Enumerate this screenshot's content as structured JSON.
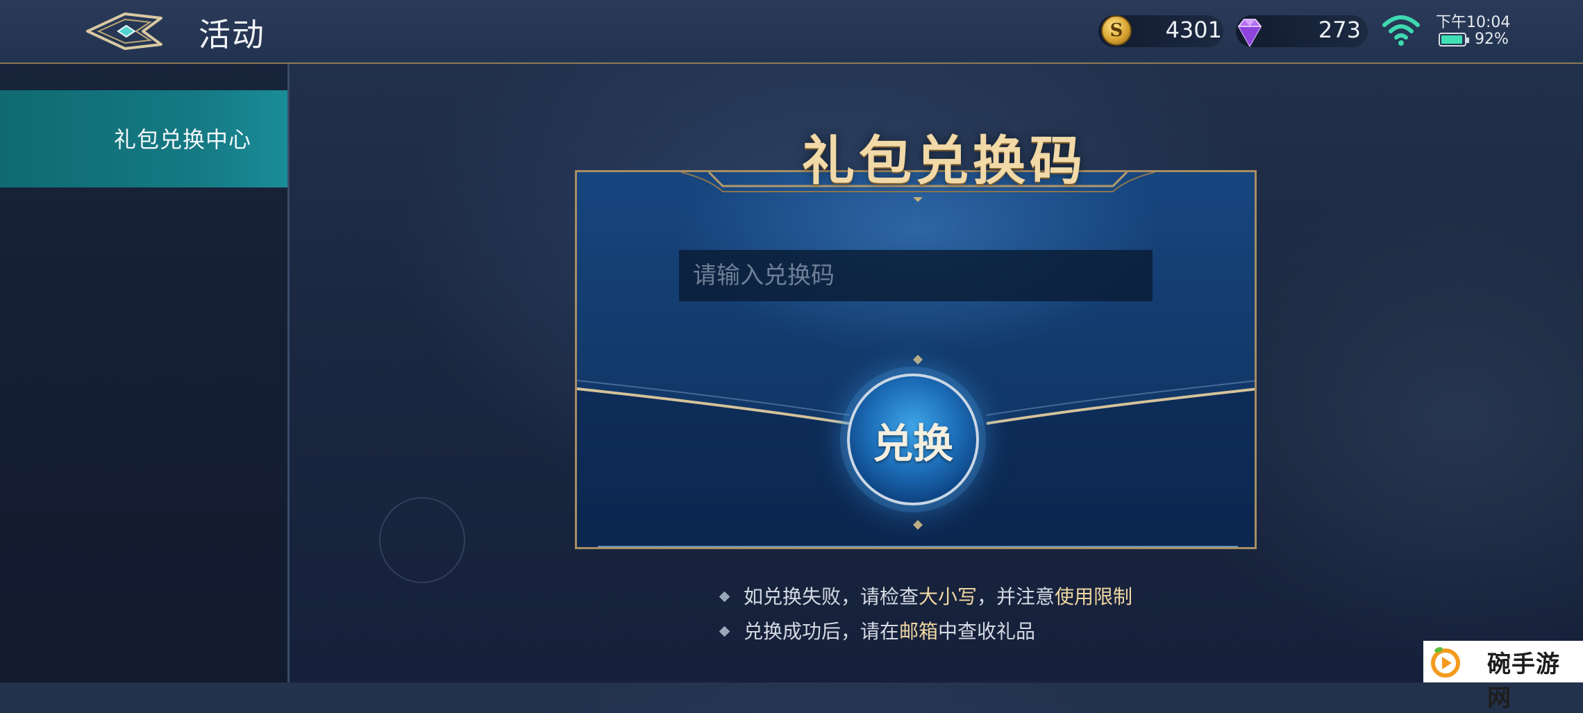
{
  "header": {
    "title": "活动",
    "gold": "4301",
    "gems": "273",
    "time": "下午10:04",
    "battery": "92%",
    "coin_symbol": "S"
  },
  "sidebar": {
    "items": [
      {
        "label": "礼包兑换中心",
        "selected": true
      }
    ]
  },
  "card": {
    "title": "礼包兑换码",
    "input_placeholder": "请输入兑换码",
    "input_value": "",
    "redeem_label": "兑换"
  },
  "tips": [
    {
      "parts": [
        "如兑换失败，请检查",
        "大小写",
        "，并注意",
        "使用限制"
      ]
    },
    {
      "parts": [
        "兑换成功后，请在",
        "邮箱",
        "中查收礼品"
      ]
    }
  ],
  "watermark": {
    "text": "碗手游网"
  },
  "colors": {
    "accent_gold": "#f0d7a3",
    "sidebar_selected": "#157a84",
    "card_blue": "#17457e",
    "wifi": "#3fd8b0"
  },
  "icons": {
    "back": "back-arrow-icon",
    "coin": "coin-icon",
    "gem": "diamond-icon",
    "wifi": "wifi-icon",
    "battery": "battery-icon"
  }
}
